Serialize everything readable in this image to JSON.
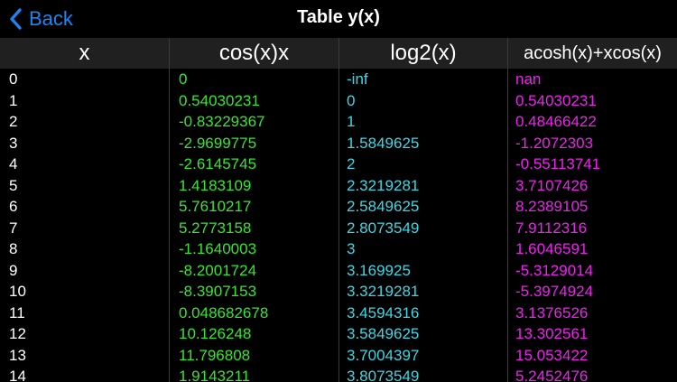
{
  "navbar": {
    "back_label": "Back",
    "title": "Table y(x)"
  },
  "colors": {
    "accent": "#1a86f5",
    "x_column": "#ffffff",
    "cos_column": "#36e62c",
    "log_column": "#3ad8e6",
    "acosh_column": "#ee22ee",
    "header_bg": "#202020",
    "background": "#000000"
  },
  "icons": {
    "back": "chevron-left-icon"
  },
  "table": {
    "headers": [
      "x",
      "cos(x)x",
      "log2(x)",
      "acosh(x)+xcos(x)"
    ],
    "rows": [
      {
        "x": "0",
        "cos": "0",
        "log": "-inf",
        "acosh": "nan"
      },
      {
        "x": "1",
        "cos": "0.54030231",
        "log": "0",
        "acosh": "0.54030231"
      },
      {
        "x": "2",
        "cos": "-0.83229367",
        "log": "1",
        "acosh": "0.48466422"
      },
      {
        "x": "3",
        "cos": "-2.9699775",
        "log": "1.5849625",
        "acosh": "-1.2072303"
      },
      {
        "x": "4",
        "cos": "-2.6145745",
        "log": "2",
        "acosh": "-0.55113741"
      },
      {
        "x": "5",
        "cos": "1.4183109",
        "log": "2.3219281",
        "acosh": "3.7107426"
      },
      {
        "x": "6",
        "cos": "5.7610217",
        "log": "2.5849625",
        "acosh": "8.2389105"
      },
      {
        "x": "7",
        "cos": "5.2773158",
        "log": "2.8073549",
        "acosh": "7.9112316"
      },
      {
        "x": "8",
        "cos": "-1.1640003",
        "log": "3",
        "acosh": "1.6046591"
      },
      {
        "x": "9",
        "cos": "-8.2001724",
        "log": "3.169925",
        "acosh": "-5.3129014"
      },
      {
        "x": "10",
        "cos": "-8.3907153",
        "log": "3.3219281",
        "acosh": "-5.3974924"
      },
      {
        "x": "11",
        "cos": "0.048682678",
        "log": "3.4594316",
        "acosh": "3.1376526"
      },
      {
        "x": "12",
        "cos": "10.126248",
        "log": "3.5849625",
        "acosh": "13.302561"
      },
      {
        "x": "13",
        "cos": "11.796808",
        "log": "3.7004397",
        "acosh": "15.053422"
      },
      {
        "x": "14",
        "cos": "1.9143211",
        "log": "3.8073549",
        "acosh": "5.2452476"
      }
    ]
  }
}
